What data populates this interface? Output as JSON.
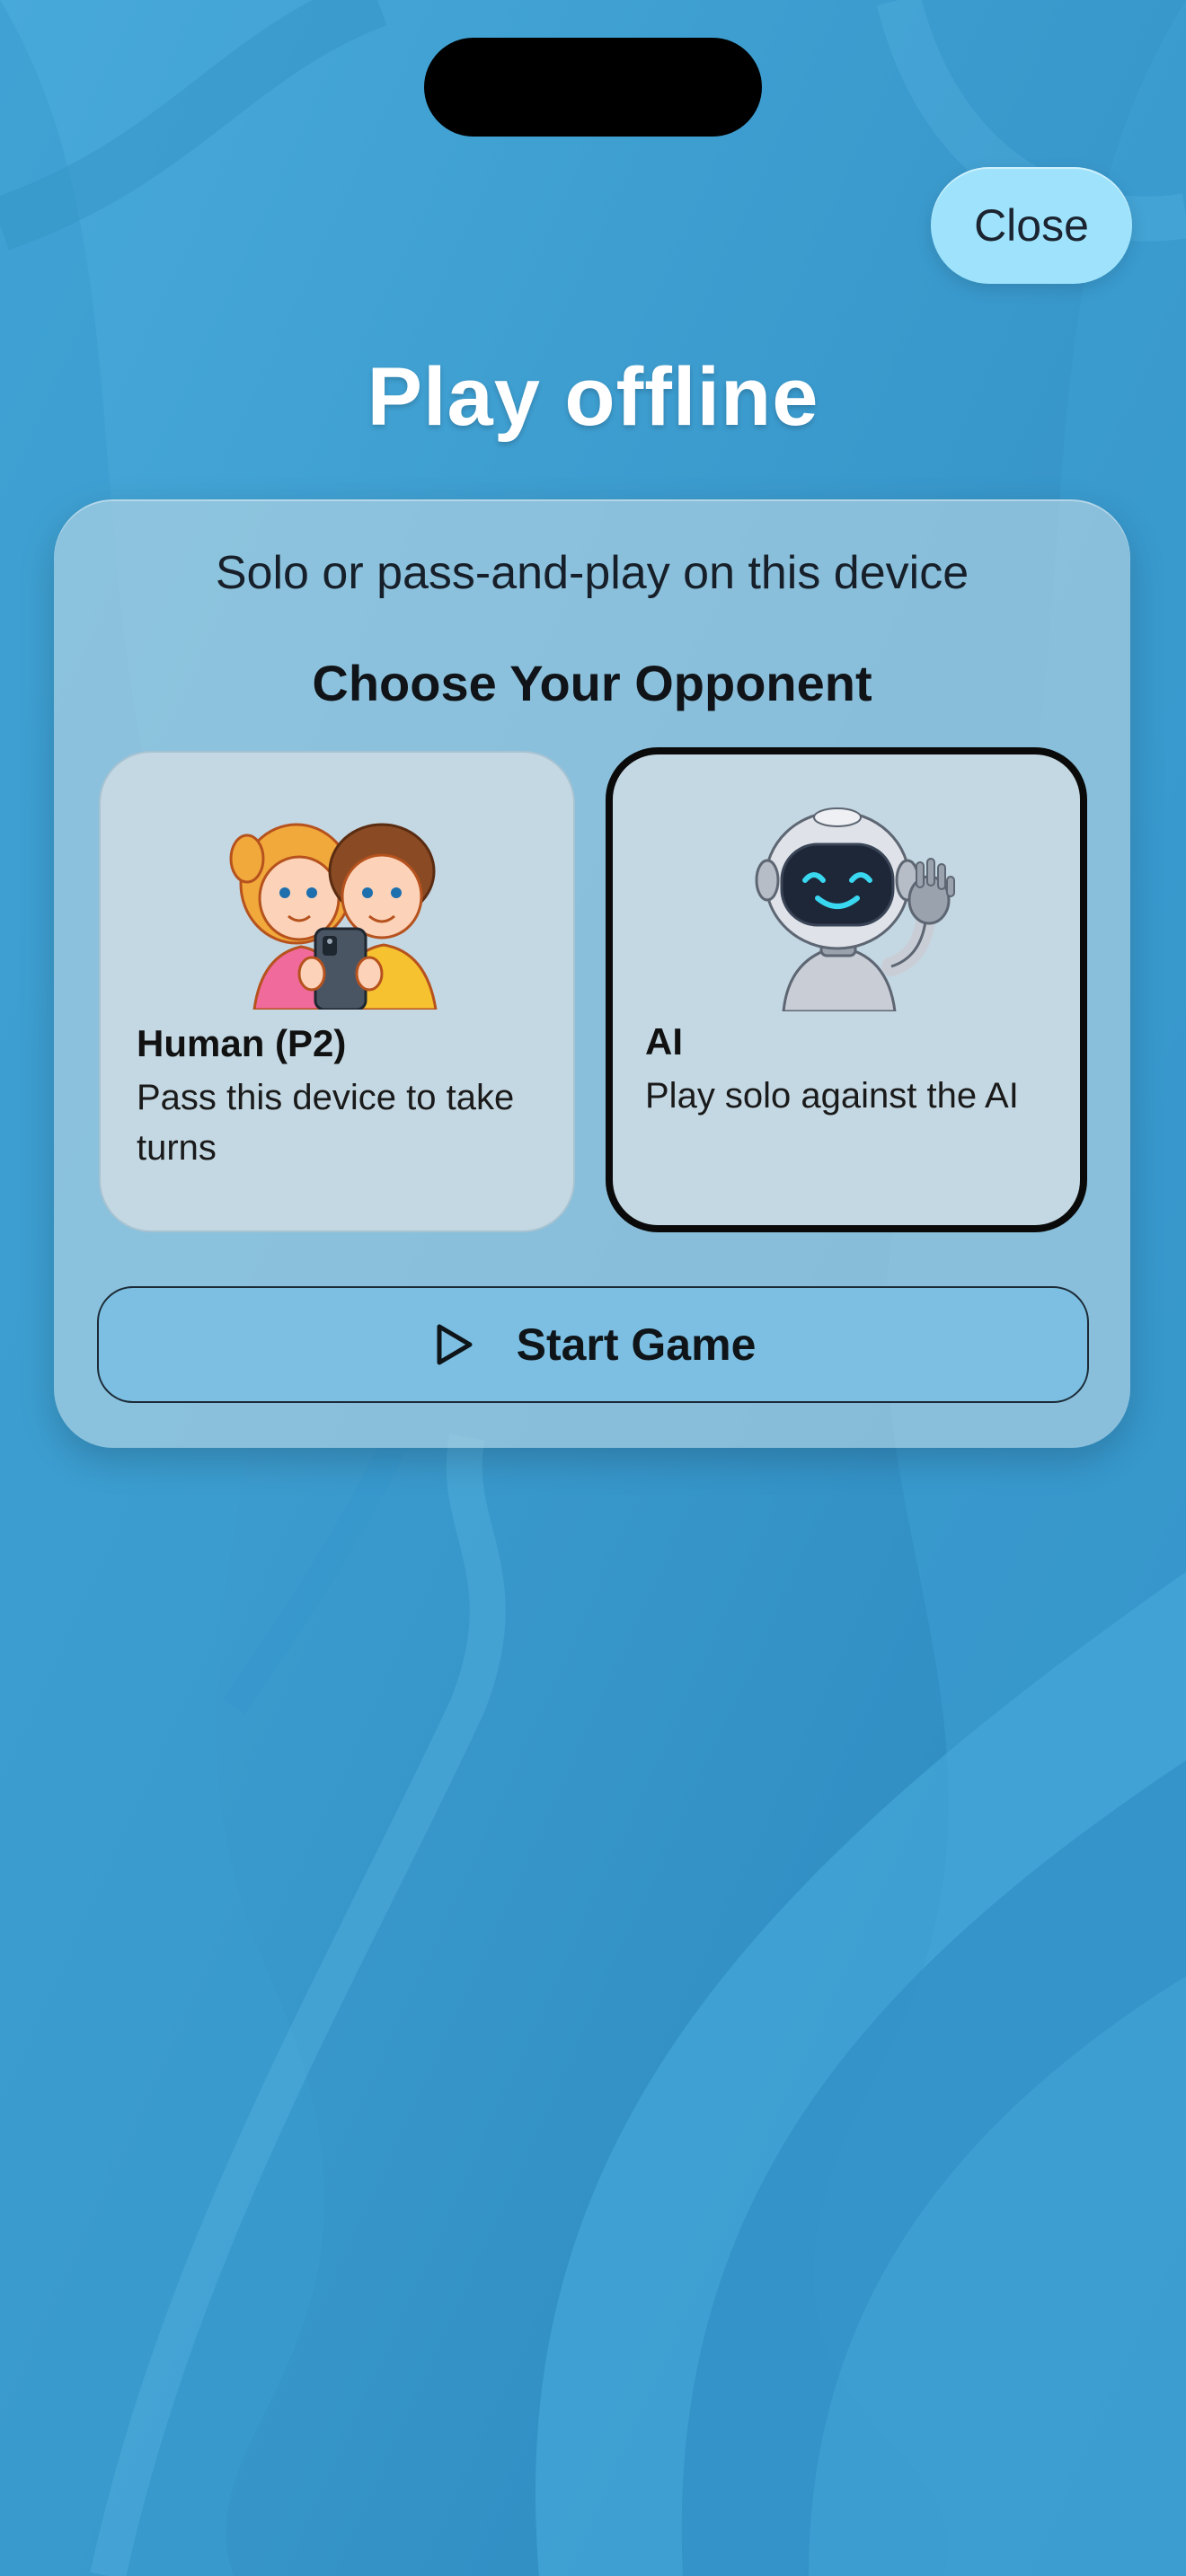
{
  "screen": {
    "title": "Play offline",
    "close_label": "Close",
    "accent_color": "#9ee3fb",
    "background_color": "#2f8fc4"
  },
  "card": {
    "subtitle": "Solo or pass-and-play on this device",
    "choose_heading": "Choose Your Opponent",
    "options": [
      {
        "title": "Human (P2)",
        "description": "Pass this device to take turns",
        "icon": "two-kids-sharing-phone-illustration",
        "selected": false
      },
      {
        "title": "AI",
        "description": "Play solo against the AI",
        "icon": "waving-robot-illustration",
        "selected": true
      }
    ],
    "start_label": "Start Game",
    "start_icon": "play-icon"
  }
}
